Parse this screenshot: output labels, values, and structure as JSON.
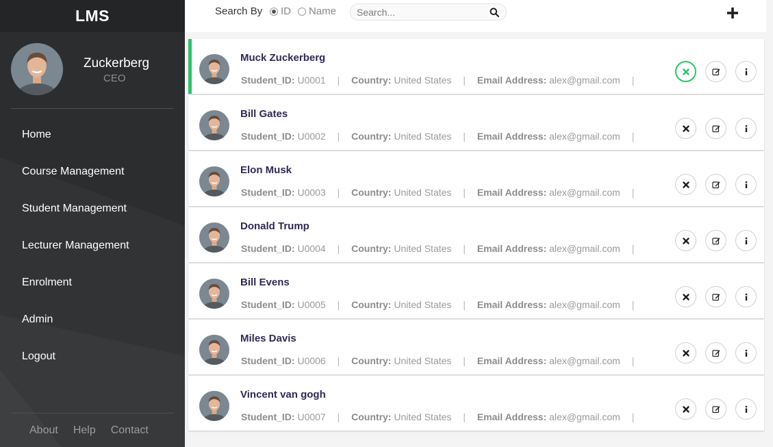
{
  "brand": "LMS",
  "profile": {
    "name": "Zuckerberg",
    "role": "CEO"
  },
  "nav": [
    "Home",
    "Course Management",
    "Student Management",
    "Lecturer Management",
    "Enrolment",
    "Admin",
    "Logout"
  ],
  "footer": [
    "About",
    "Help",
    "Contact"
  ],
  "search": {
    "label": "Search By",
    "options": [
      {
        "label": "ID",
        "selected": true
      },
      {
        "label": "Name",
        "selected": false
      }
    ],
    "placeholder": "Search..."
  },
  "labels": {
    "student_id": "Student_ID:",
    "country": "Country:",
    "email": "Email Address:"
  },
  "colors": {
    "accent": "#2bc46b",
    "sidebar": "#2c2d2f",
    "name": "#2d2a52"
  },
  "icons": {
    "add": "plus-icon",
    "search": "magnifier-icon",
    "delete": "close-icon",
    "edit": "edit-icon",
    "info": "info-icon"
  },
  "students": [
    {
      "name": "Muck Zuckerberg",
      "id": "U0001",
      "country": "United States",
      "email": "alex@gmail.com",
      "active": true
    },
    {
      "name": "Bill Gates",
      "id": "U0002",
      "country": "United States",
      "email": "alex@gmail.com",
      "active": false
    },
    {
      "name": "Elon Musk",
      "id": "U0003",
      "country": "United States",
      "email": "alex@gmail.com",
      "active": false
    },
    {
      "name": "Donald Trump",
      "id": "U0004",
      "country": "United States",
      "email": "alex@gmail.com",
      "active": false
    },
    {
      "name": "Bill Evens",
      "id": "U0005",
      "country": "United States",
      "email": "alex@gmail.com",
      "active": false
    },
    {
      "name": "Miles Davis",
      "id": "U0006",
      "country": "United States",
      "email": "alex@gmail.com",
      "active": false
    },
    {
      "name": "Vincent van gogh",
      "id": "U0007",
      "country": "United States",
      "email": "alex@gmail.com",
      "active": false
    }
  ]
}
